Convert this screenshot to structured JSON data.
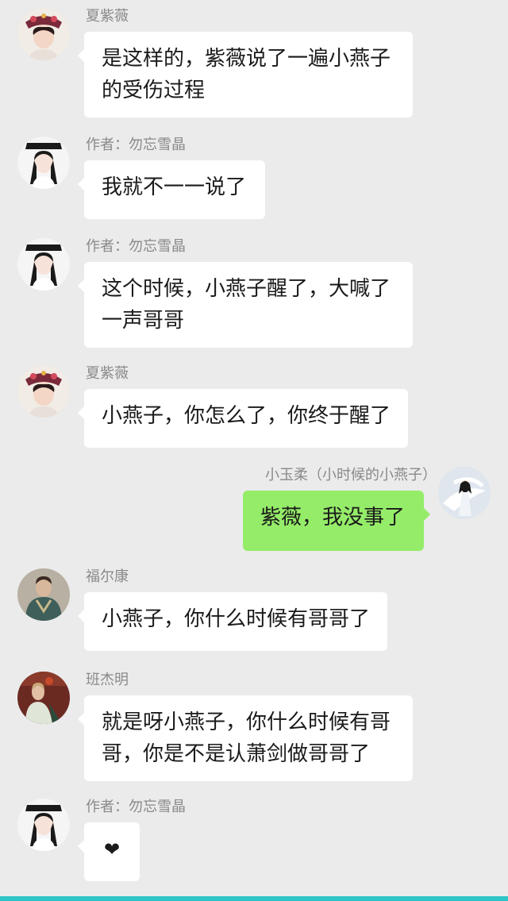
{
  "colors": {
    "background": "#ebebeb",
    "bubble_in": "#ffffff",
    "bubble_out": "#95ec69",
    "sender_name": "#8a8a8a",
    "bottom_bar": "#2ec4c8"
  },
  "messages": [
    {
      "sender": "夏紫薇",
      "text": "是这样的，紫薇说了一遍小燕子\n的受伤过程",
      "side": "left",
      "avatar": "ziwei-avatar"
    },
    {
      "sender": "作者：勿忘雪晶",
      "text": "我就不一一说了",
      "side": "left",
      "avatar": "author-avatar"
    },
    {
      "sender": "作者：勿忘雪晶",
      "text": "这个时候，小燕子醒了，大喊了\n一声哥哥",
      "side": "left",
      "avatar": "author-avatar"
    },
    {
      "sender": "夏紫薇",
      "text": "小燕子，你怎么了，你终于醒了",
      "side": "left",
      "avatar": "ziwei-avatar"
    },
    {
      "sender": "小玉柔（小时候的小燕子）",
      "text": "紫薇，我没事了",
      "side": "right",
      "avatar": "xiaoyurou-avatar"
    },
    {
      "sender": "福尔康",
      "text": "小燕子，你什么时候有哥哥了",
      "side": "left",
      "avatar": "erkang-avatar"
    },
    {
      "sender": "班杰明",
      "text": "就是呀小燕子，你什么时候有哥\n哥，你是不是认萧剑做哥哥了",
      "side": "left",
      "avatar": "banjieming-avatar"
    },
    {
      "sender": "作者：勿忘雪晶",
      "text": "❤",
      "side": "left",
      "avatar": "author-avatar"
    }
  ]
}
